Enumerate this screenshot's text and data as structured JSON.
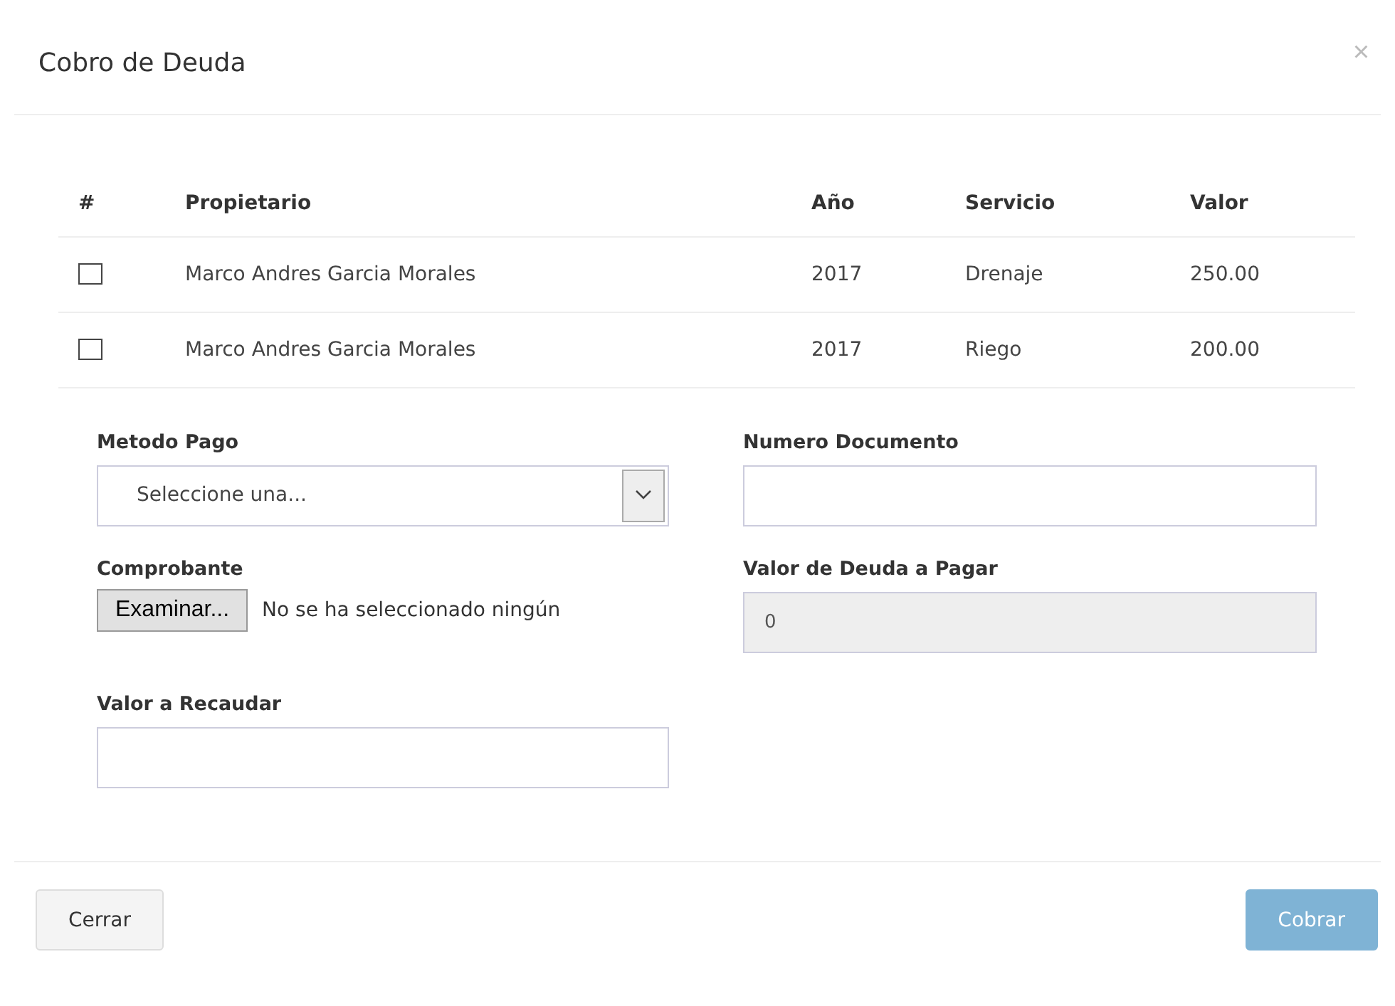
{
  "modal": {
    "title": "Cobro de Deuda",
    "close": "×"
  },
  "table": {
    "columns": [
      "#",
      "Propietario",
      "Año",
      "Servicio",
      "Valor"
    ],
    "rows": [
      {
        "checked": false,
        "owner": "Marco Andres Garcia Morales",
        "year": "2017",
        "service": "Drenaje",
        "value": "250.00"
      },
      {
        "checked": false,
        "owner": "Marco Andres Garcia Morales",
        "year": "2017",
        "service": "Riego",
        "value": "200.00"
      }
    ]
  },
  "form": {
    "payment_method": {
      "label": "Metodo Pago",
      "value": "Seleccione una..."
    },
    "document_number": {
      "label": "Numero Documento"
    },
    "receipt": {
      "label": "Comprobante",
      "button": "Examinar...",
      "status": "No se ha seleccionado ningún"
    },
    "debt_value": {
      "label": "Valor de Deuda a Pagar",
      "value": "0",
      "disabled": true
    },
    "collect_value": {
      "label": "Valor a Recaudar"
    }
  },
  "footer": {
    "close_button": "Cerrar",
    "submit_button": {
      "label": "Cobrar",
      "disabled": true
    }
  }
}
